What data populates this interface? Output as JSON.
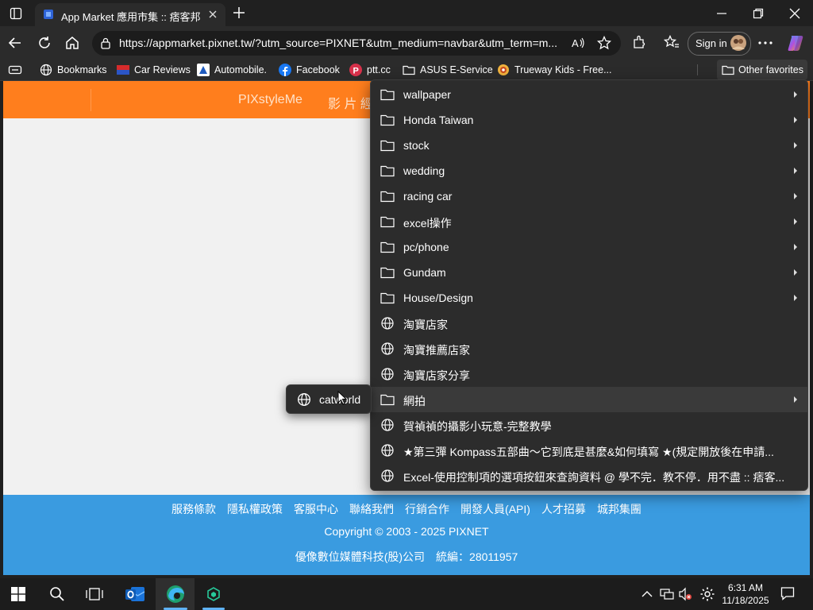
{
  "browser": {
    "tab_title": "App Market 應用市集 :: 痞客邦",
    "url": "https://appmarket.pixnet.tw/?utm_source=PIXNET&utm_medium=navbar&utm_term=m...",
    "signin_label": "Sign in"
  },
  "favorites": [
    {
      "label": "Bookmarks",
      "icon": "globe-icon"
    },
    {
      "label": "Car Reviews",
      "icon": "car-reviews-icon"
    },
    {
      "label": "Automobile.",
      "icon": "automobile-icon"
    },
    {
      "label": "Facebook",
      "icon": "facebook-icon"
    },
    {
      "label": "ptt.cc",
      "icon": "ptt-icon"
    },
    {
      "label": "ASUS E-Service",
      "icon": "folder-icon"
    },
    {
      "label": "Trueway Kids - Free...",
      "icon": "trueway-icon"
    }
  ],
  "other_favorites_label": "Other favorites",
  "page": {
    "nav_brand": "PIXstyleMe",
    "nav_item": "影 片 經",
    "footer_links": [
      "服務條款",
      "隱私權政策",
      "客服中心",
      "聯絡我們",
      "行銷合作",
      "開發人員(API)",
      "人才招募",
      "城邦集團"
    ],
    "copyright": "Copyright © 2003 - 2025 PIXNET",
    "company": "優像數位媒體科技(股)公司　統編：28011957"
  },
  "menu": {
    "items": [
      {
        "label": "wallpaper",
        "type": "folder"
      },
      {
        "label": "Honda Taiwan",
        "type": "folder"
      },
      {
        "label": "stock",
        "type": "folder"
      },
      {
        "label": "wedding",
        "type": "folder"
      },
      {
        "label": "racing car",
        "type": "folder"
      },
      {
        "label": "excel操作",
        "type": "folder"
      },
      {
        "label": "pc/phone",
        "type": "folder"
      },
      {
        "label": "Gundam",
        "type": "folder"
      },
      {
        "label": "House/Design",
        "type": "folder"
      },
      {
        "label": "淘寶店家",
        "type": "link"
      },
      {
        "label": "淘寶推薦店家",
        "type": "link"
      },
      {
        "label": "淘寶店家分享",
        "type": "link"
      },
      {
        "label": "網拍",
        "type": "folder"
      },
      {
        "label": "賀禎禎的攝影小玩意-完整教學",
        "type": "link"
      },
      {
        "label": "★第三彈 Kompass五部曲～它到底是甚麼&如何填寫 ★(規定開放後在申請...",
        "type": "link"
      },
      {
        "label": "Excel-使用控制項的選項按鈕來查詢資料 @ 學不完．教不停．用不盡 :: 痞客...",
        "type": "link"
      }
    ],
    "highlighted_index": 12,
    "submenu_item": "catworld"
  },
  "taskbar": {
    "time": "6:31 AM",
    "date": "11/18/2025"
  },
  "colors": {
    "orange": "#ff7e1d",
    "footer_blue": "#3a9be0"
  }
}
